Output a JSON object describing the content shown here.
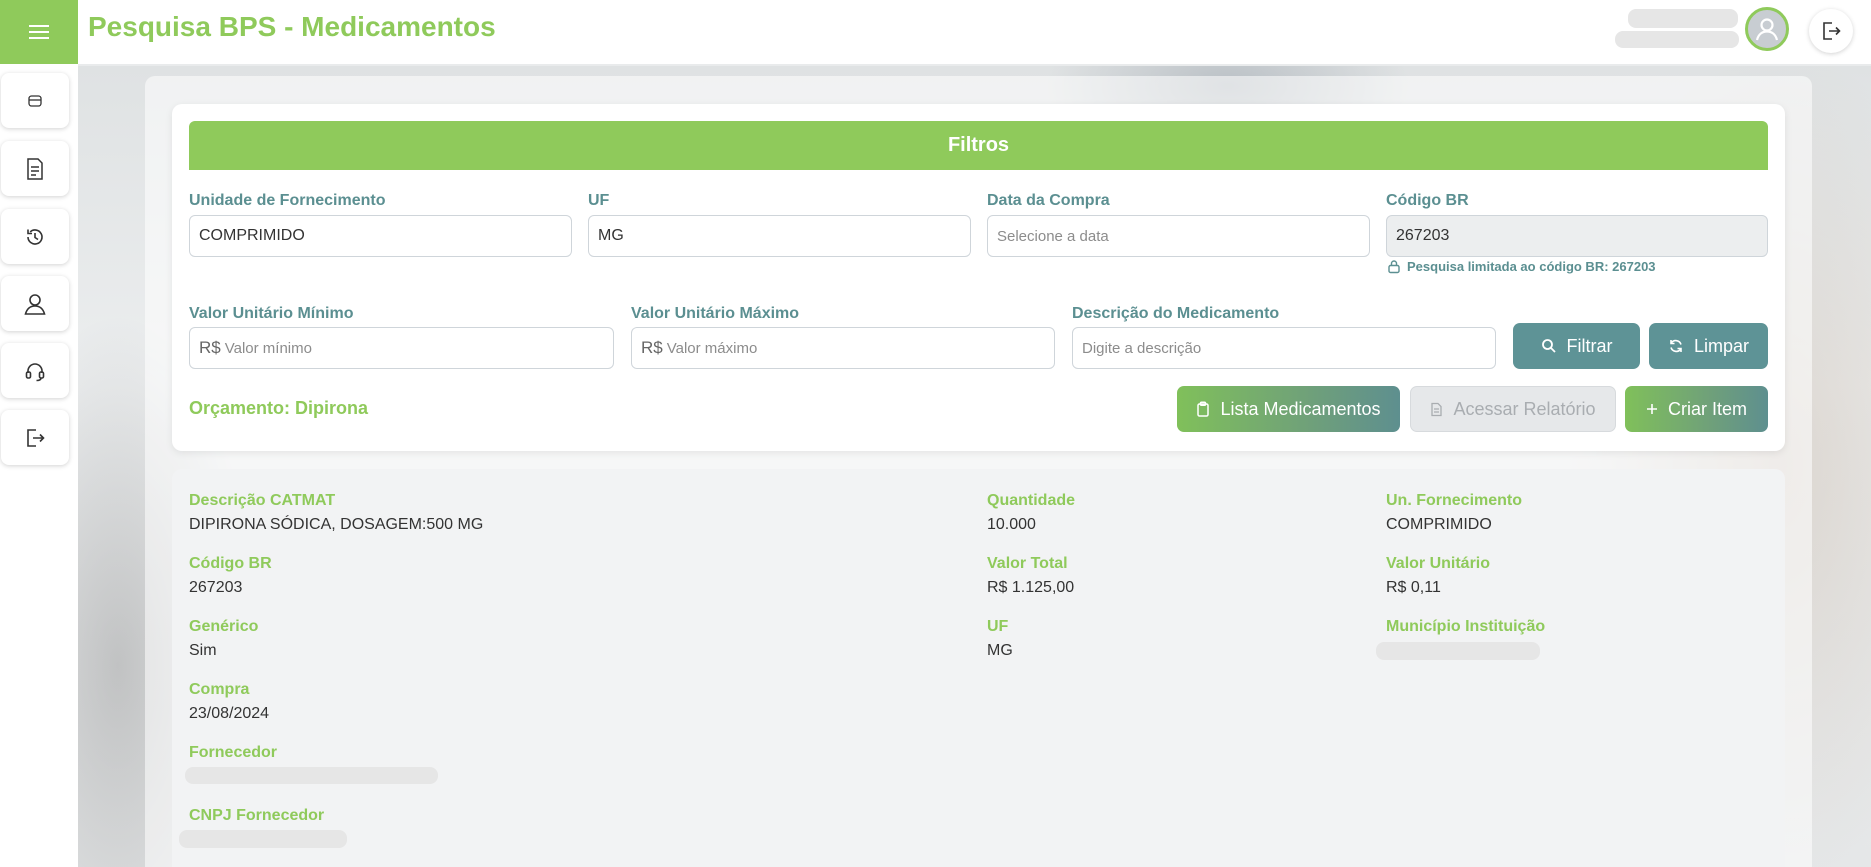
{
  "header": {
    "title": "Pesquisa BPS - Medicamentos",
    "menu_icon": "hamburger-icon",
    "avatar_icon": "user-avatar-icon",
    "logout_icon": "logout-icon"
  },
  "sidebar": {
    "items": [
      {
        "name": "home",
        "icon": "box-icon"
      },
      {
        "name": "reports",
        "icon": "document-icon"
      },
      {
        "name": "history",
        "icon": "history-icon"
      },
      {
        "name": "profile",
        "icon": "user-icon"
      },
      {
        "name": "support",
        "icon": "headset-icon"
      },
      {
        "name": "logout",
        "icon": "logout-icon"
      }
    ]
  },
  "filters": {
    "title": "Filtros",
    "unidade": {
      "label": "Unidade de Fornecimento",
      "value": "COMPRIMIDO"
    },
    "uf": {
      "label": "UF",
      "value": "MG"
    },
    "data_compra": {
      "label": "Data da Compra",
      "placeholder": "Selecione a data"
    },
    "codigo_br": {
      "label": "Código BR",
      "value": "267203",
      "note": "Pesquisa limitada ao código BR: 267203"
    },
    "valor_min": {
      "label": "Valor Unitário Mínimo",
      "prefix": "R$",
      "placeholder": "Valor mínimo"
    },
    "valor_max": {
      "label": "Valor Unitário Máximo",
      "prefix": "R$",
      "placeholder": "Valor máximo"
    },
    "descricao": {
      "label": "Descrição do Medicamento",
      "placeholder": "Digite a descrição"
    },
    "btn_filtrar": "Filtrar",
    "btn_limpar": "Limpar",
    "budget": "Orçamento: Dipirona",
    "btn_lista": "Lista Medicamentos",
    "btn_relatorio": "Acessar Relatório",
    "btn_criar": "Criar Item"
  },
  "details": {
    "descricao_catmat": {
      "label": "Descrição CATMAT",
      "value": "DIPIRONA SÓDICA, DOSAGEM:500 MG"
    },
    "quantidade": {
      "label": "Quantidade",
      "value": "10.000"
    },
    "un_fornecimento": {
      "label": "Un. Fornecimento",
      "value": "COMPRIMIDO"
    },
    "codigo_br": {
      "label": "Código BR",
      "value": "267203"
    },
    "valor_total": {
      "label": "Valor Total",
      "value": "R$ 1.125,00"
    },
    "valor_unitario": {
      "label": "Valor Unitário",
      "value": "R$ 0,11"
    },
    "generico": {
      "label": "Genérico",
      "value": "Sim"
    },
    "uf": {
      "label": "UF",
      "value": "MG"
    },
    "municipio": {
      "label": "Município Instituição"
    },
    "compra": {
      "label": "Compra",
      "value": "23/08/2024"
    },
    "fornecedor": {
      "label": "Fornecedor"
    },
    "cnpj": {
      "label": "CNPJ Fornecedor"
    }
  },
  "colors": {
    "primary_green": "#8fca5b",
    "teal": "#5e9396",
    "label_teal": "#5b8f91"
  }
}
